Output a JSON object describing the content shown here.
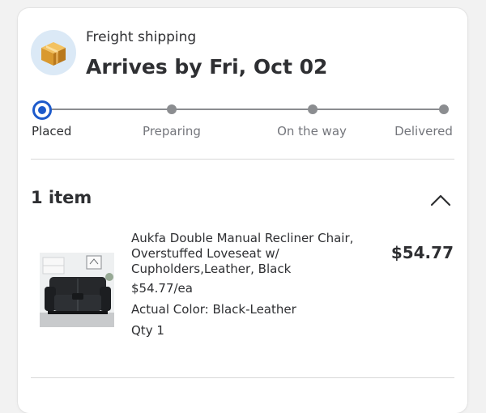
{
  "shipment": {
    "icon": "package-box-icon",
    "type_label": "Freight shipping",
    "arrival_text": "Arrives by Fri, Oct 02"
  },
  "tracker": {
    "current_step": "Placed",
    "steps": [
      {
        "label": "Placed"
      },
      {
        "label": "Preparing"
      },
      {
        "label": "On the way"
      },
      {
        "label": "Delivered"
      }
    ],
    "colors": {
      "active": "#1d5acb",
      "inactive": "#8b8d90"
    }
  },
  "items_section": {
    "count_label": "1 item",
    "toggle_icon": "chevron-up-icon"
  },
  "item": {
    "name": "Aukfa Double Manual Recliner Chair, Overstuffed Loveseat w/ Cupholders,Leather, Black",
    "unit_price": "$54.77/ea",
    "color": "Actual Color: Black-Leather",
    "qty": "Qty 1",
    "total": "$54.77",
    "thumbnail_icon": "loveseat-image"
  }
}
